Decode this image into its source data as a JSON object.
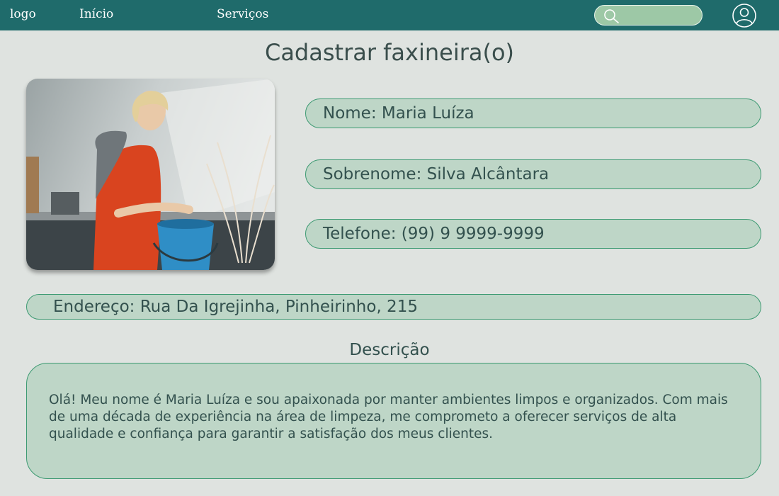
{
  "nav": {
    "logo": "logo",
    "links": [
      "Início",
      "Serviços"
    ],
    "search_icon": "search-icon",
    "user_icon": "user-icon"
  },
  "page": {
    "title": "Cadastrar faxineira(o)"
  },
  "profile": {
    "photo_alt": "photo of woman cleaning",
    "fields": {
      "nome": "Nome: Maria Luíza",
      "sobrenome": "Sobrenome: Silva Alcântara",
      "telefone": "Telefone: (99) 9 9999-9999",
      "endereco": "Endereço: Rua Da Igrejinha, Pinheirinho, 215"
    }
  },
  "description": {
    "title": "Descrição",
    "text": "Olá! Meu nome é Maria Luíza e sou apaixonada por manter ambientes limpos e organizados. Com mais de uma década de experiência na área de limpeza, me comprometo a oferecer serviços de alta qualidade e confiança para garantir a satisfação dos meus clientes."
  },
  "colors": {
    "navbar": "#1f6b6b",
    "background": "#dfe3e0",
    "field_fill": "#bed6c7",
    "field_border": "#3d9a72",
    "search_fill": "#9dc8a6"
  }
}
